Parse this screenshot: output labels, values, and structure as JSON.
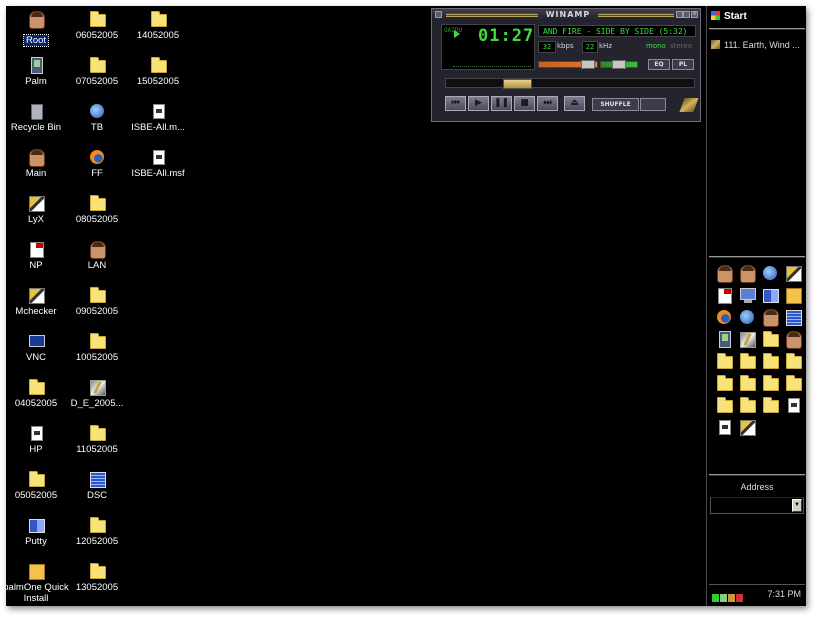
{
  "desktop": {
    "icons": [
      {
        "label": "Root",
        "icon": "user-icon",
        "selected": true
      },
      {
        "label": "06052005",
        "icon": "folder-icon"
      },
      {
        "label": "14052005",
        "icon": "folder-icon"
      },
      {
        "label": "Palm",
        "icon": "palm-icon"
      },
      {
        "label": "07052005",
        "icon": "folder-icon"
      },
      {
        "label": "15052005",
        "icon": "folder-icon"
      },
      {
        "label": "Recycle Bin",
        "icon": "recycle-bin-icon"
      },
      {
        "label": "TB",
        "icon": "thunderbird-icon"
      },
      {
        "label": "ISBE-All.m...",
        "icon": "document-icon"
      },
      {
        "label": "Main",
        "icon": "user-icon"
      },
      {
        "label": "FF",
        "icon": "firefox-icon"
      },
      {
        "label": "ISBE-All.msf",
        "icon": "document-icon"
      },
      {
        "label": "LyX",
        "icon": "lyx-icon"
      },
      {
        "label": "08052005",
        "icon": "folder-icon"
      },
      {
        "label": "NP",
        "icon": "notepad-icon"
      },
      {
        "label": "LAN",
        "icon": "user-icon"
      },
      {
        "label": "Mchecker",
        "icon": "mchecker-icon"
      },
      {
        "label": "09052005",
        "icon": "folder-icon"
      },
      {
        "label": "VNC",
        "icon": "vnc-icon"
      },
      {
        "label": "10052005",
        "icon": "folder-icon"
      },
      {
        "label": "04052005",
        "icon": "folder-icon"
      },
      {
        "label": "D_E_2005...",
        "icon": "winamp-file-icon"
      },
      {
        "label": "HP",
        "icon": "printer-icon"
      },
      {
        "label": "11052005",
        "icon": "folder-icon"
      },
      {
        "label": "05052005",
        "icon": "folder-icon"
      },
      {
        "label": "DSC",
        "icon": "spreadsheet-icon"
      },
      {
        "label": "Putty",
        "icon": "putty-icon"
      },
      {
        "label": "12052005",
        "icon": "folder-icon"
      },
      {
        "label": "palmOne Quick Install",
        "icon": "palm-install-icon"
      },
      {
        "label": "13052005",
        "icon": "folder-icon"
      }
    ]
  },
  "winamp": {
    "title": "WINAMP",
    "oaidu": "OAIDU",
    "time": "01:27",
    "marquee": "AND FIRE - SIDE BY SIDE (5:32)",
    "kbps": "32",
    "kbps_label": "kbps",
    "khz": "22",
    "khz_label": "kHz",
    "mono_label": "mono",
    "stereo_label": "stereo",
    "eq_label": "EQ",
    "pl_label": "PL",
    "shuffle_label": "SHUFFLE",
    "seek_fraction": 0.26
  },
  "sidebar": {
    "start_label": "Start",
    "task_item": "111. Earth, Wind ...",
    "quicklaunch": [
      "user-icon",
      "user-icon",
      "media-icon",
      "lyx-icon",
      "np-icon",
      "monitor-icon",
      "putty-icon",
      "quick-install-icon",
      "firefox-icon",
      "thunderbird-icon",
      "user-icon",
      "spreadsheet-icon",
      "palm-icon",
      "winamp-icon",
      "folder-icon",
      "user-icon",
      "folder-icon",
      "folder-icon",
      "folder-icon",
      "folder-icon",
      "folder-icon",
      "folder-icon",
      "folder-icon",
      "folder-icon",
      "folder-icon",
      "folder-icon",
      "folder-icon",
      "document-icon",
      "document-icon",
      "mchecker-icon"
    ],
    "address_label": "Address",
    "clock": "7:31 PM"
  },
  "colors": {
    "desktop_bg": "#000000",
    "lcd_green": "#3fdc3f",
    "winamp_body": "#24242f",
    "selection": "#0a246a"
  }
}
